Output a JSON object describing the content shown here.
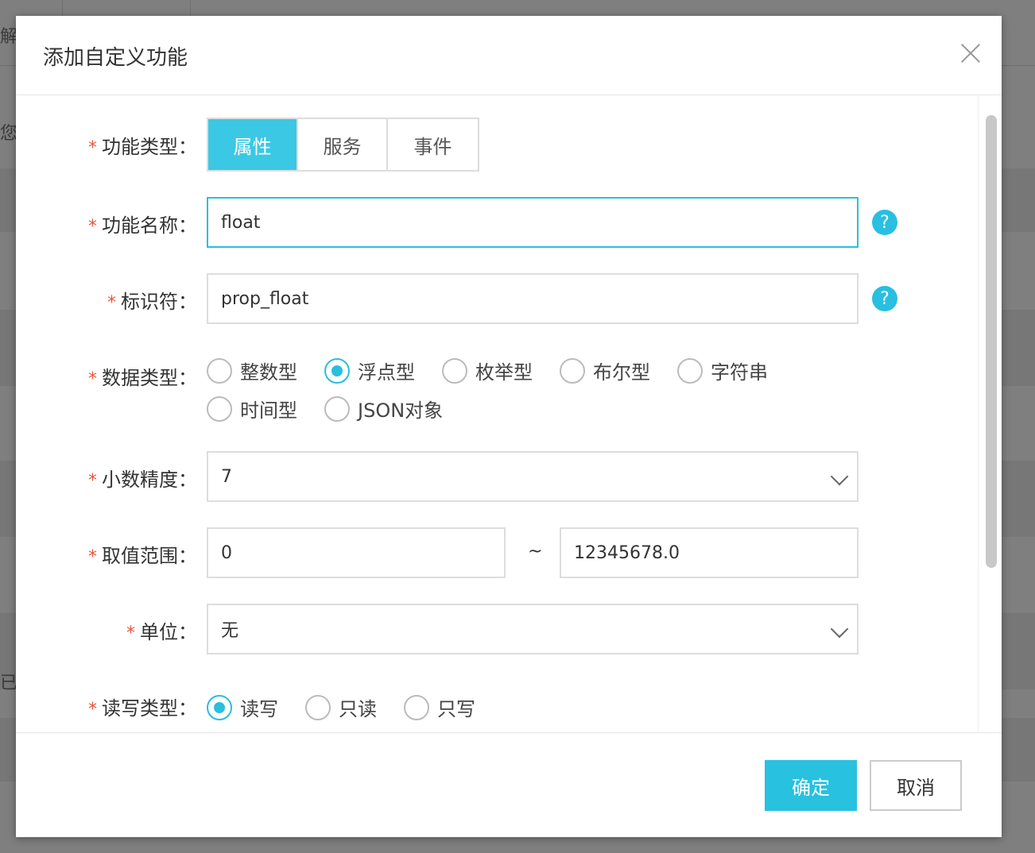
{
  "background": {
    "fragments": [
      "解",
      "您们",
      "已创"
    ]
  },
  "modal": {
    "title": "添加自定义功能",
    "fields": {
      "type": {
        "required_mark": "*",
        "label": "功能类型：",
        "options": [
          "属性",
          "服务",
          "事件"
        ],
        "selected": "属性"
      },
      "name": {
        "required_mark": "*",
        "label": "功能名称：",
        "value": "float",
        "help": "?"
      },
      "identifier": {
        "required_mark": "*",
        "label": "标识符：",
        "value": "prop_float",
        "help": "?"
      },
      "data_type": {
        "required_mark": "*",
        "label": "数据类型：",
        "options": [
          "整数型",
          "浮点型",
          "枚举型",
          "布尔型",
          "字符串",
          "时间型",
          "JSON对象"
        ],
        "selected": "浮点型"
      },
      "precision": {
        "required_mark": "*",
        "label": "小数精度：",
        "value": "7"
      },
      "range": {
        "required_mark": "*",
        "label": "取值范围：",
        "min": "0",
        "separator": "~",
        "max": "12345678.0"
      },
      "unit": {
        "required_mark": "*",
        "label": "单位：",
        "value": "无"
      },
      "rw_type": {
        "required_mark": "*",
        "label": "读写类型：",
        "options": [
          "读写",
          "只读",
          "只写"
        ],
        "selected": "读写"
      }
    },
    "footer": {
      "confirm": "确定",
      "cancel": "取消"
    }
  },
  "colors": {
    "accent": "#28bfe0",
    "required": "#e8563a"
  }
}
